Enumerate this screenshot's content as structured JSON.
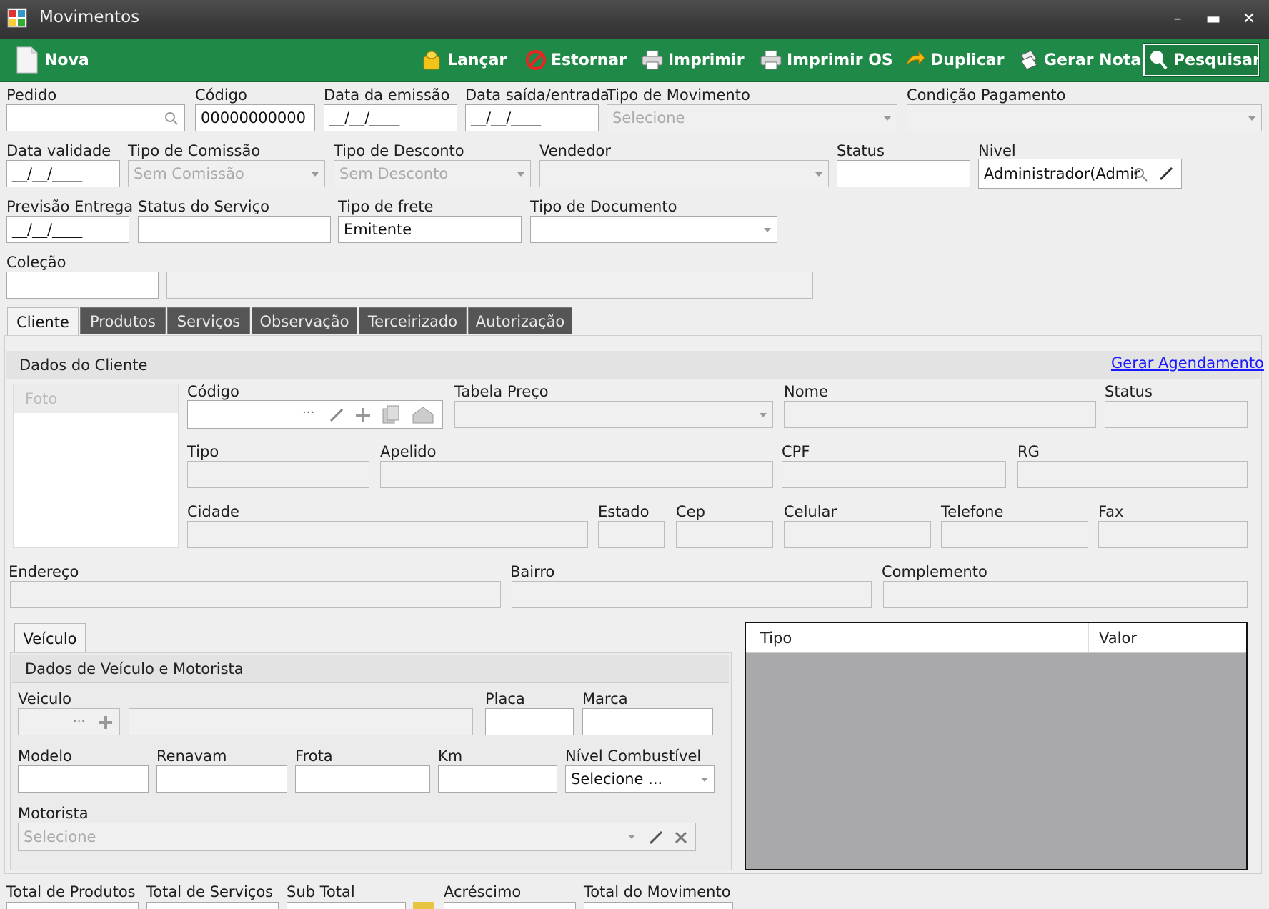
{
  "window": {
    "title": "Movimentos"
  },
  "toolbar": {
    "nova": "Nova",
    "lancar": "Lançar",
    "estornar": "Estornar",
    "imprimir": "Imprimir",
    "imprimir_os": "Imprimir OS",
    "duplicar": "Duplicar",
    "gerar_nota": "Gerar Nota",
    "pesquisar": "Pesquisar"
  },
  "form": {
    "pedido": {
      "label": "Pedido",
      "value": ""
    },
    "codigo": {
      "label": "Código",
      "value": "00000000000"
    },
    "data_emissao": {
      "label": "Data da emissão",
      "value": "__/__/____"
    },
    "data_saida": {
      "label": "Data saída/entrada",
      "value": "__/__/____"
    },
    "tipo_movimento": {
      "label": "Tipo de Movimento",
      "value": "Selecione"
    },
    "condicao_pagamento": {
      "label": "Condição Pagamento",
      "value": ""
    },
    "data_validade": {
      "label": "Data validade",
      "value": "__/__/____"
    },
    "tipo_comissao": {
      "label": "Tipo de Comissão",
      "value": "Sem Comissão"
    },
    "tipo_desconto": {
      "label": "Tipo de Desconto",
      "value": "Sem Desconto"
    },
    "vendedor": {
      "label": "Vendedor",
      "value": ""
    },
    "status": {
      "label": "Status",
      "value": ""
    },
    "nivel": {
      "label": "Nivel",
      "value": "Administrador(Admir"
    },
    "previsao_entrega": {
      "label": "Previsão Entrega",
      "value": "__/__/____"
    },
    "status_servico": {
      "label": "Status do Serviço",
      "value": ""
    },
    "tipo_frete": {
      "label": "Tipo de frete",
      "value": "Emitente"
    },
    "tipo_documento": {
      "label": "Tipo de Documento",
      "value": ""
    },
    "colecao": {
      "label": "Coleção",
      "value": ""
    }
  },
  "tabs": [
    "Cliente",
    "Produtos",
    "Serviços",
    "Observação",
    "Terceirizado",
    "Autorização"
  ],
  "cliente": {
    "section": "Dados do Cliente",
    "link": "Gerar Agendamento",
    "foto": "Foto",
    "codigo": "Código",
    "tabela_preco": "Tabela Preço",
    "nome": "Nome",
    "status": "Status",
    "tipo": "Tipo",
    "apelido": "Apelido",
    "cpf": "CPF",
    "rg": "RG",
    "cidade": "Cidade",
    "estado": "Estado",
    "cep": "Cep",
    "celular": "Celular",
    "telefone": "Telefone",
    "fax": "Fax",
    "endereco": "Endereço",
    "bairro": "Bairro",
    "complemento": "Complemento",
    "codigo_dots": "···"
  },
  "veiculo": {
    "tab": "Veículo",
    "section": "Dados de Veículo e Motorista",
    "veiculo": "Veiculo",
    "placa": "Placa",
    "marca": "Marca",
    "modelo": "Modelo",
    "renavam": "Renavam",
    "frota": "Frota",
    "km": "Km",
    "nivel_combustivel": "Nível Combustível",
    "nivel_combustivel_value": "Selecione ...",
    "motorista": "Motorista",
    "motorista_value": "Selecione",
    "dots": "···"
  },
  "grid": {
    "columns": [
      "Tipo",
      "Valor"
    ]
  },
  "totals": {
    "produtos": "Total de Produtos",
    "servicos": "Total de Serviços",
    "sub_total": "Sub Total",
    "acrescimo": "Acréscimo",
    "movimento": "Total do Movimento"
  },
  "colors": {
    "toolbar": "#1f8a47",
    "titlebar": "#3a3a3a",
    "grid_bg": "#a9a9ab",
    "link": "#1a1aff"
  }
}
